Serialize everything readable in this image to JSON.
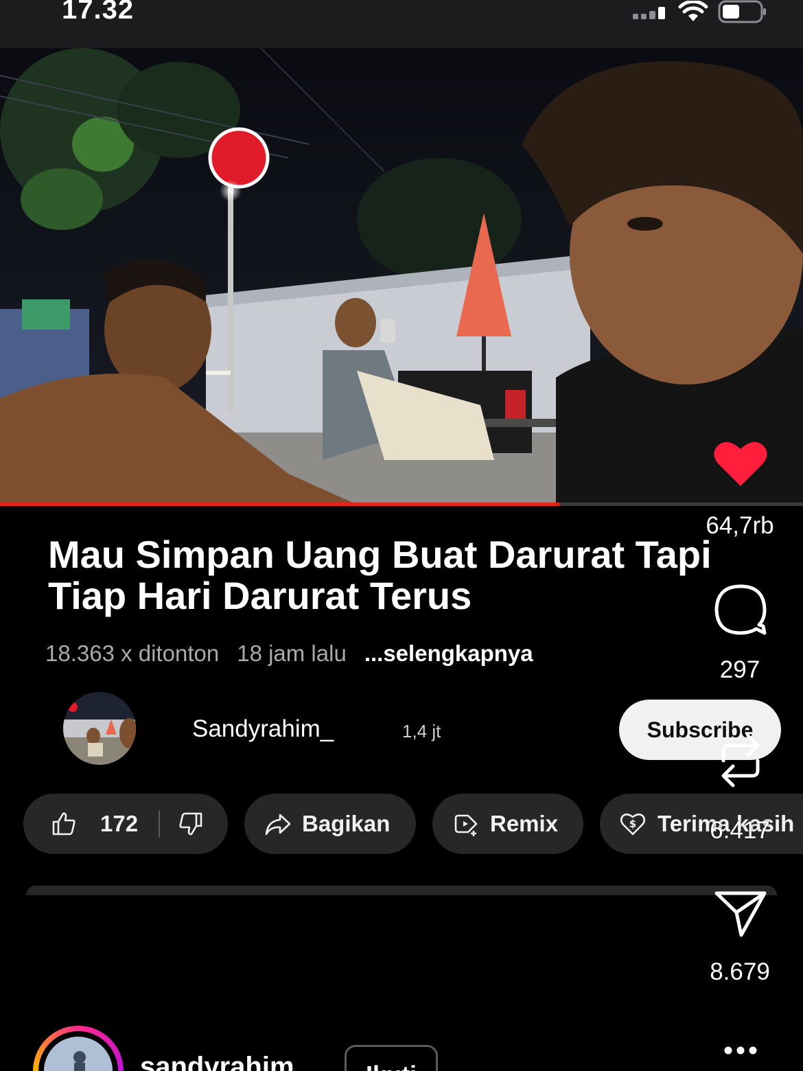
{
  "status_bar": {
    "time": "17.32"
  },
  "video": {
    "progress": 0.697
  },
  "title": "Mau Simpan Uang Buat Darurat Tapi Tiap Hari Darurat Terus",
  "meta": {
    "views": "18.363 x ditonton",
    "time_ago": "18 jam lalu",
    "more": "...selengkapnya"
  },
  "channel": {
    "name": "Sandyrahim_",
    "subscribers": "1,4 jt",
    "subscribe_label": "Subscribe"
  },
  "actions": {
    "likes": "172",
    "share": "Bagikan",
    "remix": "Remix",
    "thanks": "Terima kasih"
  },
  "rail": {
    "likes": "64,7rb",
    "comments": "297",
    "reposts": "6.417",
    "shares": "8.679"
  },
  "user": {
    "name": "sandyrahim",
    "follow_label": "Ikuti"
  },
  "colors": {
    "heart": "#ff1f3d",
    "progress": "#e62117",
    "story_ring": "#e1306c"
  }
}
